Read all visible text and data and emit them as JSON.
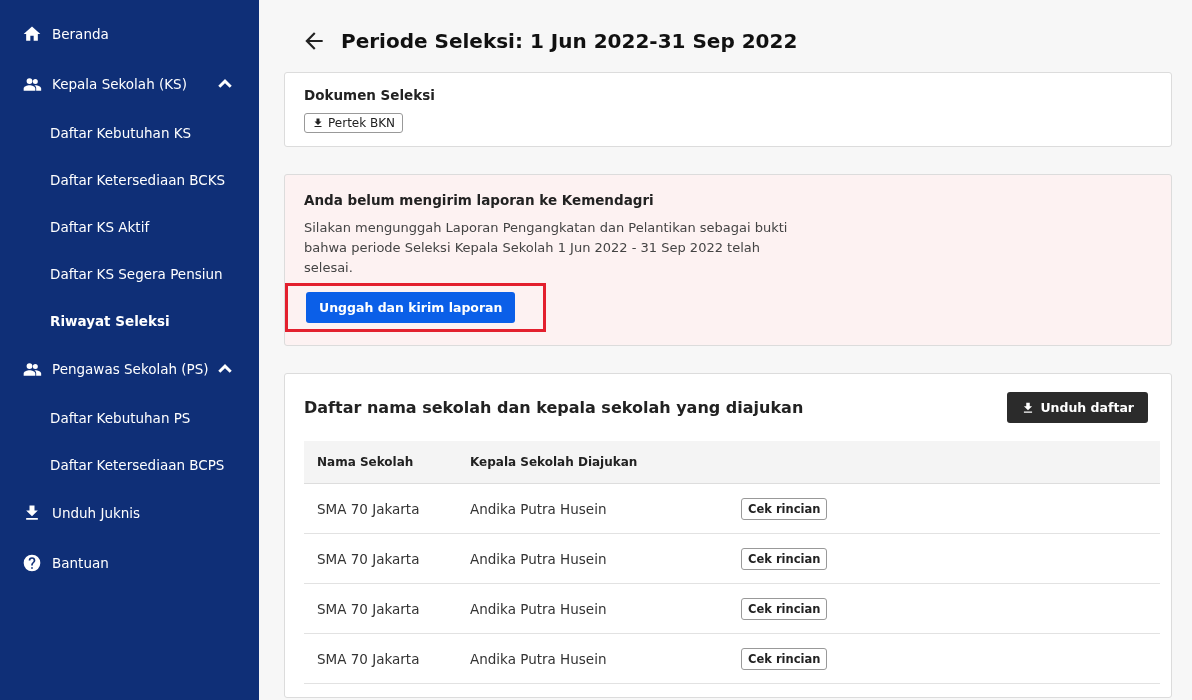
{
  "sidebar": {
    "items": [
      {
        "kind": "home",
        "label": "Beranda",
        "selected": false
      },
      {
        "kind": "group",
        "label": "Kepala Sekolah (KS)",
        "selected": false,
        "expanded": true,
        "children": [
          {
            "label": "Daftar Kebutuhan KS",
            "selected": false
          },
          {
            "label": "Daftar Ketersediaan BCKS",
            "selected": false
          },
          {
            "label": "Daftar KS Aktif",
            "selected": false
          },
          {
            "label": "Daftar KS Segera Pensiun",
            "selected": false
          },
          {
            "label": "Riwayat Seleksi",
            "selected": true
          }
        ]
      },
      {
        "kind": "group",
        "label": "Pengawas Sekolah (PS)",
        "selected": false,
        "expanded": true,
        "children": [
          {
            "label": "Daftar Kebutuhan PS",
            "selected": false
          },
          {
            "label": "Daftar Ketersediaan BCPS",
            "selected": false
          }
        ]
      },
      {
        "kind": "download",
        "label": "Unduh Juknis",
        "selected": false
      },
      {
        "kind": "help",
        "label": "Bantuan",
        "selected": false
      }
    ]
  },
  "page": {
    "title": "Periode Seleksi: 1 Jun 2022-31 Sep 2022"
  },
  "documents": {
    "title": "Dokumen Seleksi",
    "buttons": [
      "Pertek BKN"
    ]
  },
  "alert": {
    "title": "Anda belum mengirim laporan ke Kemendagri",
    "message": "Silakan mengunggah Laporan Pengangkatan dan Pelantikan sebagai bukti bahwa periode Seleksi Kepala Sekolah 1 Jun 2022 - 31 Sep 2022 telah selesai.",
    "button": "Unggah dan kirim laporan",
    "highlighted": true
  },
  "table": {
    "title": "Daftar nama sekolah dan kepala sekolah yang diajukan",
    "download_button": "Unduh daftar",
    "columns": [
      "Nama Sekolah",
      "Kepala Sekolah Diajukan"
    ],
    "rows": [
      {
        "school": "SMA 70 Jakarta",
        "principal": "Andika Putra Husein",
        "action": "Cek rincian"
      },
      {
        "school": "SMA 70 Jakarta",
        "principal": "Andika Putra Husein",
        "action": "Cek rincian"
      },
      {
        "school": "SMA 70 Jakarta",
        "principal": "Andika Putra Husein",
        "action": "Cek rincian"
      },
      {
        "school": "SMA 70 Jakarta",
        "principal": "Andika Putra Husein",
        "action": "Cek rincian"
      }
    ]
  }
}
